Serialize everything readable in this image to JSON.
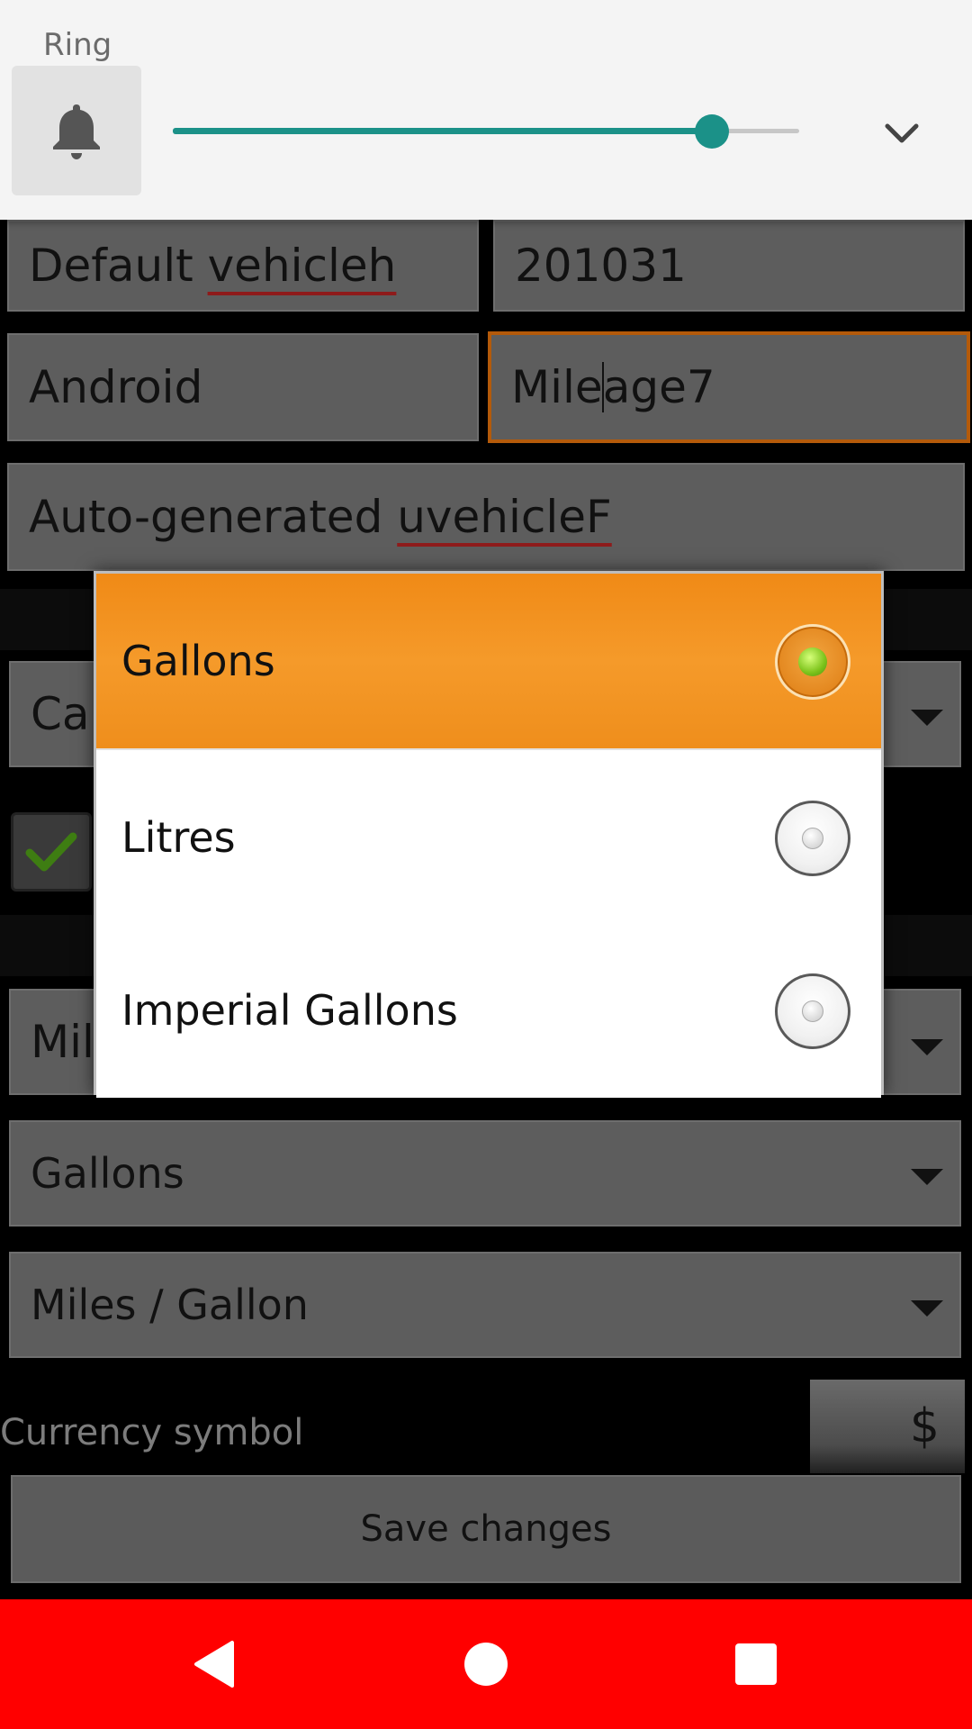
{
  "volume_panel": {
    "stream_label": "Ring",
    "level": 0.86,
    "icon": "bell-icon",
    "collapse_icon": "chevron-down-icon",
    "accent_color": "#1b9188"
  },
  "form": {
    "vehicle_name": {
      "prefix": "Default ",
      "misspelled": "vehicleh"
    },
    "vehicle_code": "201031",
    "make": "Android",
    "model": {
      "before_cursor": "Mile",
      "after_cursor": "age7"
    },
    "description": {
      "prefix": "Auto-generated ",
      "misspelled": "uvehicleF"
    },
    "vehicle_type": "Car",
    "distance_unit": "Miles",
    "volume_unit": "Gallons",
    "economy_unit": "Miles / Gallon",
    "currency_label": "Currency symbol",
    "currency_value": "$",
    "save_label": "Save changes",
    "focus_color": "#b45a0a"
  },
  "dialog": {
    "options": [
      {
        "label": "Gallons",
        "selected": true
      },
      {
        "label": "Litres",
        "selected": false
      },
      {
        "label": "Imperial Gallons",
        "selected": false
      }
    ],
    "selected_color": "#f59a2a"
  },
  "navbar": {
    "color": "#ff0000",
    "back_icon": "back-triangle-icon",
    "home_icon": "home-circle-icon",
    "recents_icon": "recents-square-icon"
  }
}
